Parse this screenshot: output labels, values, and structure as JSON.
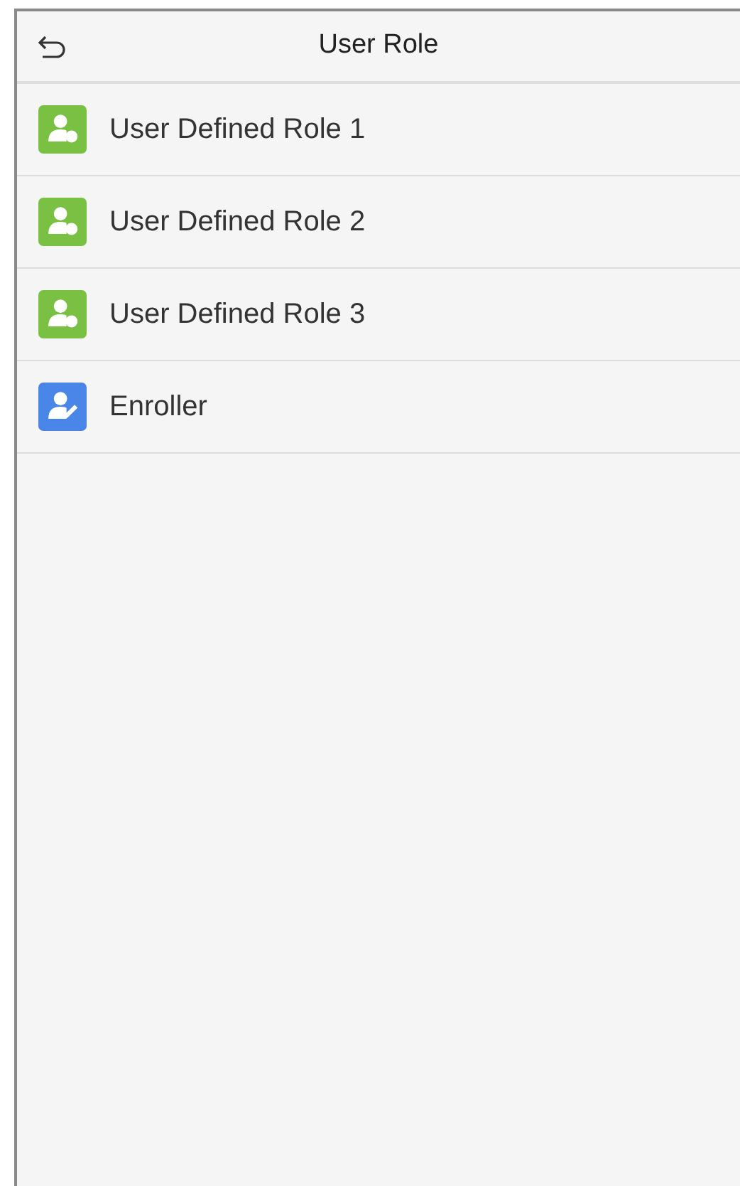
{
  "header": {
    "title": "User Role"
  },
  "roles": [
    {
      "label": "User Defined Role 1",
      "kind": "numbered",
      "color": "#7ac143"
    },
    {
      "label": "User Defined Role 2",
      "kind": "numbered",
      "color": "#7ac143"
    },
    {
      "label": "User Defined Role 3",
      "kind": "numbered",
      "color": "#7ac143"
    },
    {
      "label": "Enroller",
      "kind": "enroller",
      "color": "#4a86e8"
    }
  ]
}
